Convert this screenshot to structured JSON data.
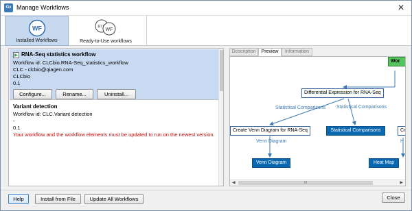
{
  "window": {
    "title": "Manage Workflows",
    "app_icon_text": "Gx",
    "close_glyph": "✕"
  },
  "top_tabs": [
    {
      "label": "Installed Workflows",
      "icon": "wf-circle-icon",
      "icon_text": "WF"
    },
    {
      "label": "Ready-to-Use workflows",
      "icon": "rtu-wf-icon",
      "icon_text_a": "RTU",
      "icon_text_b": "WF"
    }
  ],
  "workflows": [
    {
      "title": "RNA-Seq statistics workflow",
      "id_line": "Workflow id: CLCbio.RNA-Seq_statistics_workflow",
      "contact": "CLC - clcbio@qiagen.com",
      "vendor": "CLCbio",
      "version": "0.1",
      "buttons": {
        "configure": "Configure...",
        "rename": "Rename...",
        "uninstall": "Uninstall..."
      }
    },
    {
      "title": "Variant detection",
      "id_line": "Workflow id: CLC.Variant detection",
      "vendor": "-",
      "version": "0.1",
      "warning": "Your workflow and the workflow elements must be updated to run on the newest version."
    }
  ],
  "preview_tabs": [
    "Description",
    "Preview",
    "Information"
  ],
  "diagram": {
    "top_node": "Wor",
    "de_node": "Differential Expression for RNA-Seq",
    "edge_left": "Statistical Comparisons",
    "edge_right": "Statistical Comparisons",
    "venn_create": "Create Venn Diagram for RNA-Seq",
    "stat_out": "Statistical Comparisons",
    "cut_node": "Cr",
    "venn_edge": "Venn Diagram",
    "venn_out": "Venn Diagram",
    "heat_edge": "H",
    "heat_out": "Heat Map",
    "scroll_grip": "III",
    "arrow_left": "◀",
    "arrow_right": "▶"
  },
  "bottom_buttons": {
    "help": "Help",
    "install": "Install from File",
    "update_all": "Update All Workflows",
    "close": "Close"
  }
}
